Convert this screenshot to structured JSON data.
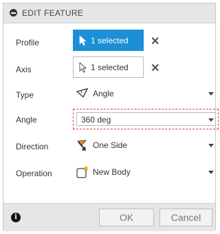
{
  "header": {
    "title": "EDIT FEATURE"
  },
  "rows": {
    "profile": {
      "label": "Profile",
      "value": "1 selected"
    },
    "axis": {
      "label": "Axis",
      "value": "1 selected"
    },
    "type": {
      "label": "Type",
      "value": "Angle"
    },
    "angle": {
      "label": "Angle",
      "value": "360 deg"
    },
    "direction": {
      "label": "Direction",
      "value": "One Side"
    },
    "operation": {
      "label": "Operation",
      "value": "New Body"
    }
  },
  "footer": {
    "info": "i",
    "ok_label": "OK",
    "cancel_label": "Cancel"
  },
  "colors": {
    "active_select": "#1c8fd6",
    "highlight_border": "#e03a3a"
  }
}
